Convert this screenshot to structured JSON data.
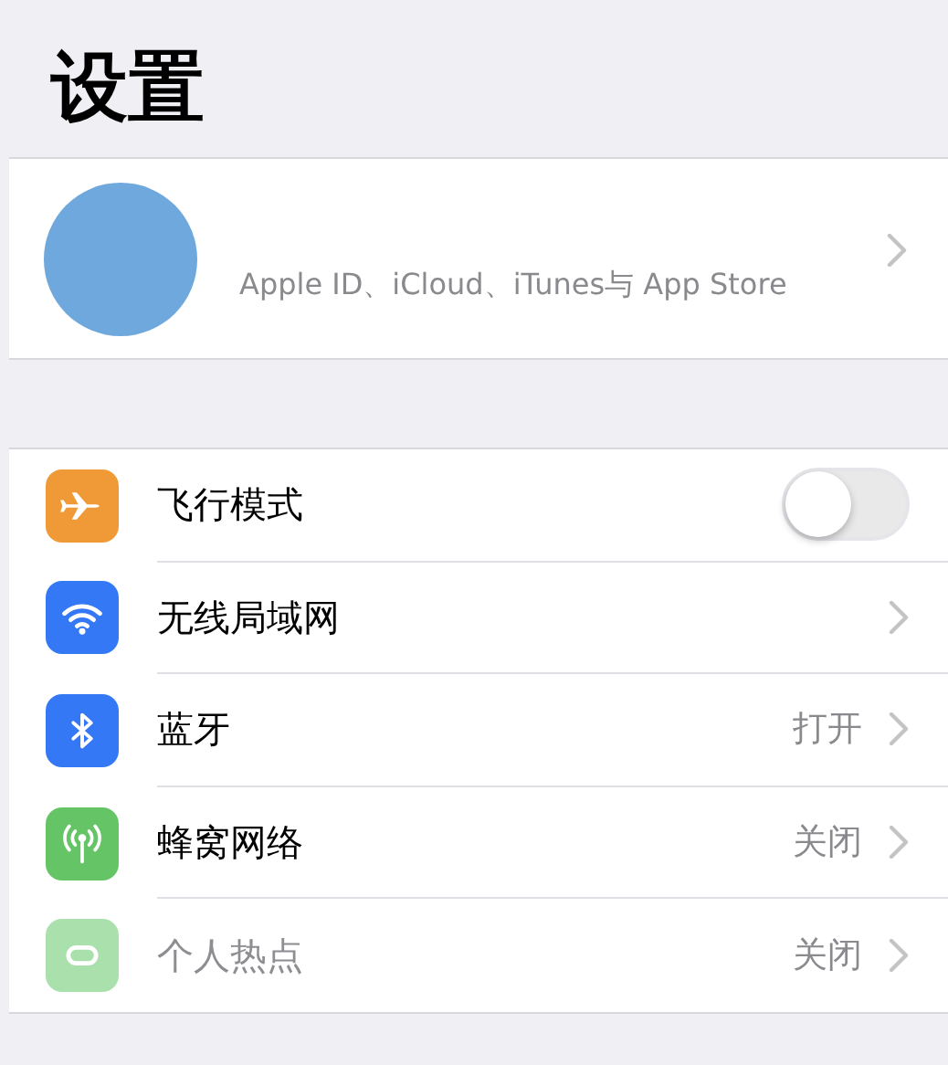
{
  "title": "设置",
  "profile": {
    "subtitle": "Apple ID、iCloud、iTunes与 App Store"
  },
  "settings": [
    {
      "label": "飞行模式",
      "kind": "toggle",
      "on": false,
      "color": "#f09a37",
      "disabled": false
    },
    {
      "label": "无线局域网",
      "kind": "link",
      "color": "#3478f6",
      "disabled": false
    },
    {
      "label": "蓝牙",
      "kind": "link",
      "value": "打开",
      "color": "#3478f6",
      "disabled": false
    },
    {
      "label": "蜂窝网络",
      "kind": "link",
      "value": "关闭",
      "color": "#65c466",
      "disabled": false
    },
    {
      "label": "个人热点",
      "kind": "link",
      "value": "关闭",
      "color": "#a9e0ac",
      "disabled": true
    }
  ]
}
